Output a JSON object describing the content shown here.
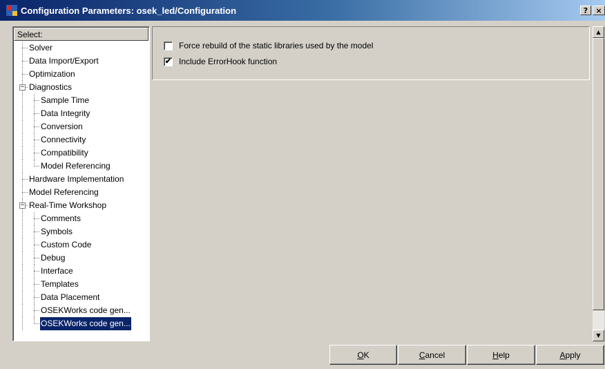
{
  "window": {
    "title": "Configuration Parameters: osek_led/Configuration",
    "help_glyph": "?",
    "close_glyph": "×"
  },
  "tree": {
    "header": "Select:",
    "items": [
      {
        "label": "Solver",
        "level": 0
      },
      {
        "label": "Data Import/Export",
        "level": 0
      },
      {
        "label": "Optimization",
        "level": 0
      },
      {
        "label": "Diagnostics",
        "level": 0,
        "expander": "−"
      },
      {
        "label": "Sample Time",
        "level": 1
      },
      {
        "label": "Data Integrity",
        "level": 1
      },
      {
        "label": "Conversion",
        "level": 1
      },
      {
        "label": "Connectivity",
        "level": 1
      },
      {
        "label": "Compatibility",
        "level": 1
      },
      {
        "label": "Model Referencing",
        "level": 1
      },
      {
        "label": "Hardware Implementation",
        "level": 0
      },
      {
        "label": "Model Referencing",
        "level": 0
      },
      {
        "label": "Real-Time Workshop",
        "level": 0,
        "expander": "−"
      },
      {
        "label": "Comments",
        "level": 1
      },
      {
        "label": "Symbols",
        "level": 1
      },
      {
        "label": "Custom Code",
        "level": 1
      },
      {
        "label": "Debug",
        "level": 1
      },
      {
        "label": "Interface",
        "level": 1
      },
      {
        "label": "Templates",
        "level": 1
      },
      {
        "label": "Data Placement",
        "level": 1
      },
      {
        "label": "OSEKWorks code gen...",
        "level": 1
      },
      {
        "label": "OSEKWorks code gen...",
        "level": 1,
        "selected": true
      }
    ]
  },
  "options": {
    "force_rebuild": {
      "label": "Force rebuild of the static libraries used by the model",
      "checked": false
    },
    "include_errorhook": {
      "label": "Include ErrorHook function",
      "checked": true,
      "check_glyph": "✔"
    }
  },
  "scrollbar": {
    "up_glyph": "▲",
    "down_glyph": "▼"
  },
  "buttons": {
    "ok": {
      "mnemonic": "O",
      "rest": "K"
    },
    "cancel": {
      "mnemonic": "C",
      "rest": "ancel"
    },
    "help": {
      "mnemonic": "H",
      "rest": "elp"
    },
    "apply": {
      "mnemonic": "A",
      "rest": "pply"
    }
  },
  "colors": {
    "titlebar_start": "#0a246a",
    "titlebar_end": "#a6caf0",
    "dialog_face": "#d4d0c8",
    "selection": "#0a246a"
  }
}
